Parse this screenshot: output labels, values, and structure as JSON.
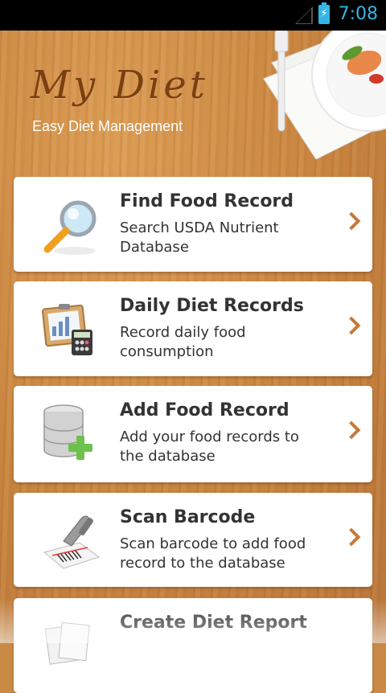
{
  "status_bar": {
    "time": "7:08"
  },
  "header": {
    "title": "My Diet",
    "subtitle": "Easy Diet Management"
  },
  "menu": [
    {
      "title": "Find Food Record",
      "description": "Search USDA Nutrient Database",
      "icon": "magnifier-icon"
    },
    {
      "title": "Daily Diet Records",
      "description": "Record daily food consumption",
      "icon": "clipboard-calculator-icon"
    },
    {
      "title": "Add Food Record",
      "description": "Add your food records to the database",
      "icon": "database-add-icon"
    },
    {
      "title": "Scan Barcode",
      "description": "Scan barcode to add food record to the database",
      "icon": "barcode-scanner-icon"
    },
    {
      "title": "Create Diet Report",
      "description": "",
      "icon": "report-icon"
    }
  ],
  "colors": {
    "accent": "#c67a3a",
    "title_brown": "#7a3f12",
    "status_blue": "#33b5e5"
  }
}
